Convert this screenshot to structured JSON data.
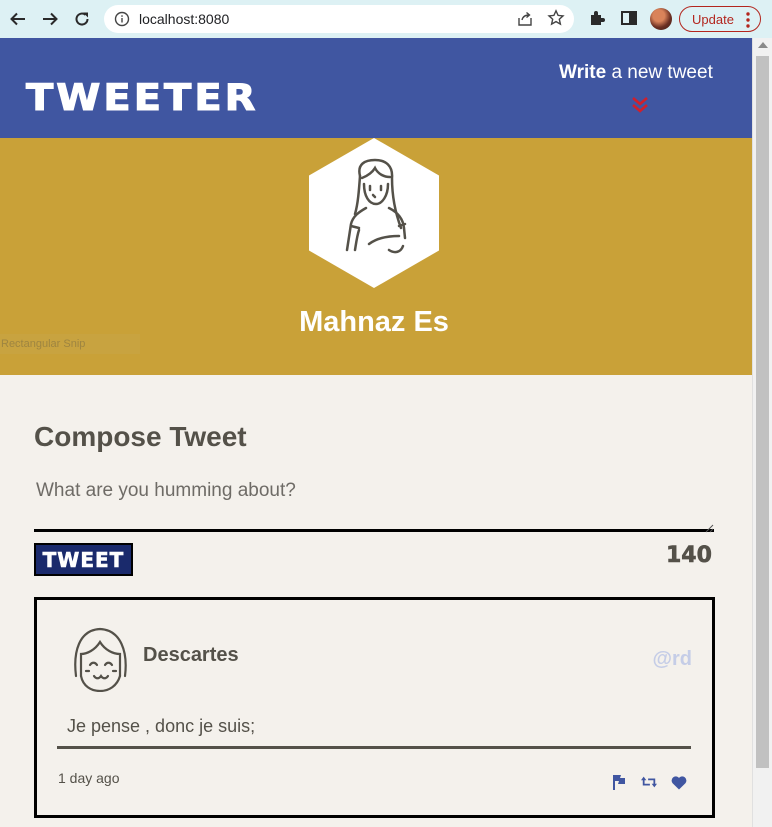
{
  "browser": {
    "url": "localhost:8080",
    "update_label": "Update"
  },
  "nav": {
    "logo": "TWEETER",
    "write_bold": "Write",
    "write_rest": " a new tweet"
  },
  "profile": {
    "name": "Mahnaz Es",
    "overlay_label": "Rectangular Snip"
  },
  "compose": {
    "title": "Compose Tweet",
    "placeholder": "What are you humming about?",
    "button_label": "TWEET",
    "counter": "140"
  },
  "tweets": [
    {
      "author": "Descartes",
      "handle": "@rd",
      "text": "Je pense , donc je suis;",
      "time": "1 day ago"
    }
  ],
  "colors": {
    "nav_bg": "#4056a1",
    "banner_bg": "#c9a138",
    "page_bg": "#f4f1ec",
    "accent_red": "#d11f2b",
    "icon_blue": "#4056a1"
  },
  "icons": {
    "actions": [
      "flag-icon",
      "retweet-icon",
      "heart-icon"
    ]
  }
}
